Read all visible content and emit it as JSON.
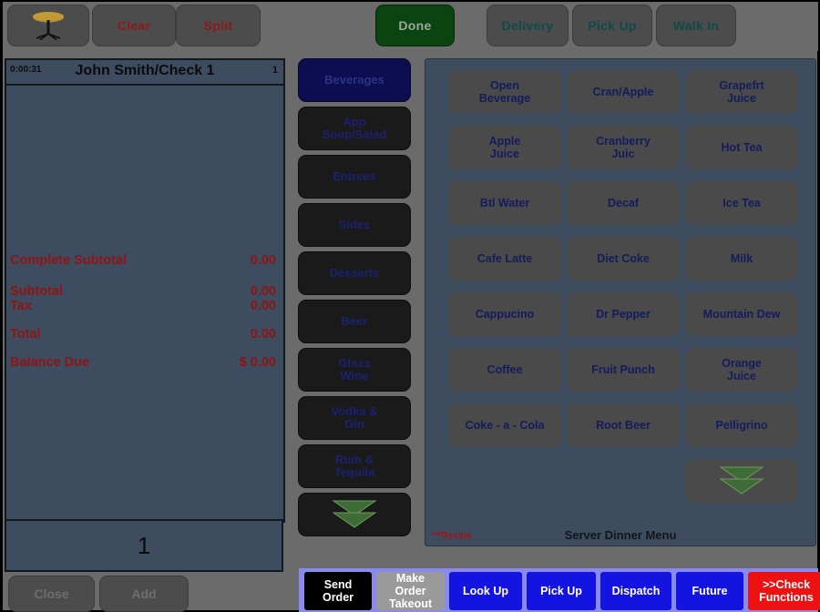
{
  "toolbar": {
    "table_icon": "round-table-icon",
    "clear_label": "Clear",
    "split_label": "Split",
    "done_label": "Done",
    "delivery_label": "Delivery",
    "pickup_label": "Pick Up",
    "walkin_label": "Walk In"
  },
  "check": {
    "timer": "0:00:31",
    "title": "John Smith/Check 1",
    "count": "1",
    "totals": [
      {
        "label": "Complete Subtotal",
        "value": "0.00"
      },
      {
        "label": "Subtotal",
        "value": "0.00"
      },
      {
        "label": "Tax",
        "value": "0.00"
      },
      {
        "label": "Total",
        "value": "0.00"
      },
      {
        "label": "Balance Due",
        "value": "$ 0.00"
      }
    ],
    "quantity": "1",
    "close_label": "Close",
    "add_label": "Add"
  },
  "categories": [
    {
      "label": "Beverages",
      "selected": true
    },
    {
      "label": "App\nSoup/Salad",
      "selected": false
    },
    {
      "label": "Entrees",
      "selected": false
    },
    {
      "label": "Sides",
      "selected": false
    },
    {
      "label": "Desserts",
      "selected": false
    },
    {
      "label": "Beer",
      "selected": false
    },
    {
      "label": "Glass\nWine",
      "selected": false
    },
    {
      "label": "Vodka &\nGin",
      "selected": false
    },
    {
      "label": "Rum &\nTequila",
      "selected": false
    },
    {
      "label": "scroll-down",
      "selected": false,
      "icon": "double-chevron-down-icon"
    }
  ],
  "menu": {
    "items": [
      "Open\nBeverage",
      "Cran/Apple",
      "Grapefrt\nJuice",
      "Apple\nJuice",
      "Cranberry\nJuic",
      "Hot Tea",
      "Btl Water",
      "Decaf",
      "Ice Tea",
      "Cafe Latte",
      "Diet Coke",
      "Milk",
      "Cappucino",
      "Dr Pepper",
      "Mountain Dew",
      "Coffee",
      "Fruit Punch",
      "Orange\nJuice",
      "Coke - a - Cola",
      "Root Beer",
      "Pelligrino"
    ],
    "scroll_icon": "double-chevron-down-icon",
    "recipe_note": "***Recipe",
    "footer_title": "Server Dinner Menu"
  },
  "functions": [
    {
      "label": "Send\nOrder",
      "style": "dark"
    },
    {
      "label": "Make\nOrder\nTakeout",
      "style": "gray"
    },
    {
      "label": "Look Up",
      "style": "blue"
    },
    {
      "label": "Pick Up",
      "style": "blue"
    },
    {
      "label": "Dispatch",
      "style": "blue"
    },
    {
      "label": "Future",
      "style": "blue"
    },
    {
      "label": ">>Check\nFunctions",
      "style": "red"
    }
  ],
  "colors": {
    "panel_bg": "#3d4c5f",
    "app_bg": "#6b6b6b",
    "accent_blue": "#1414e0",
    "accent_red": "#ee1111",
    "done_green": "#0a4410",
    "total_red": "#8f1515",
    "selected_category": "#0d0d52"
  }
}
